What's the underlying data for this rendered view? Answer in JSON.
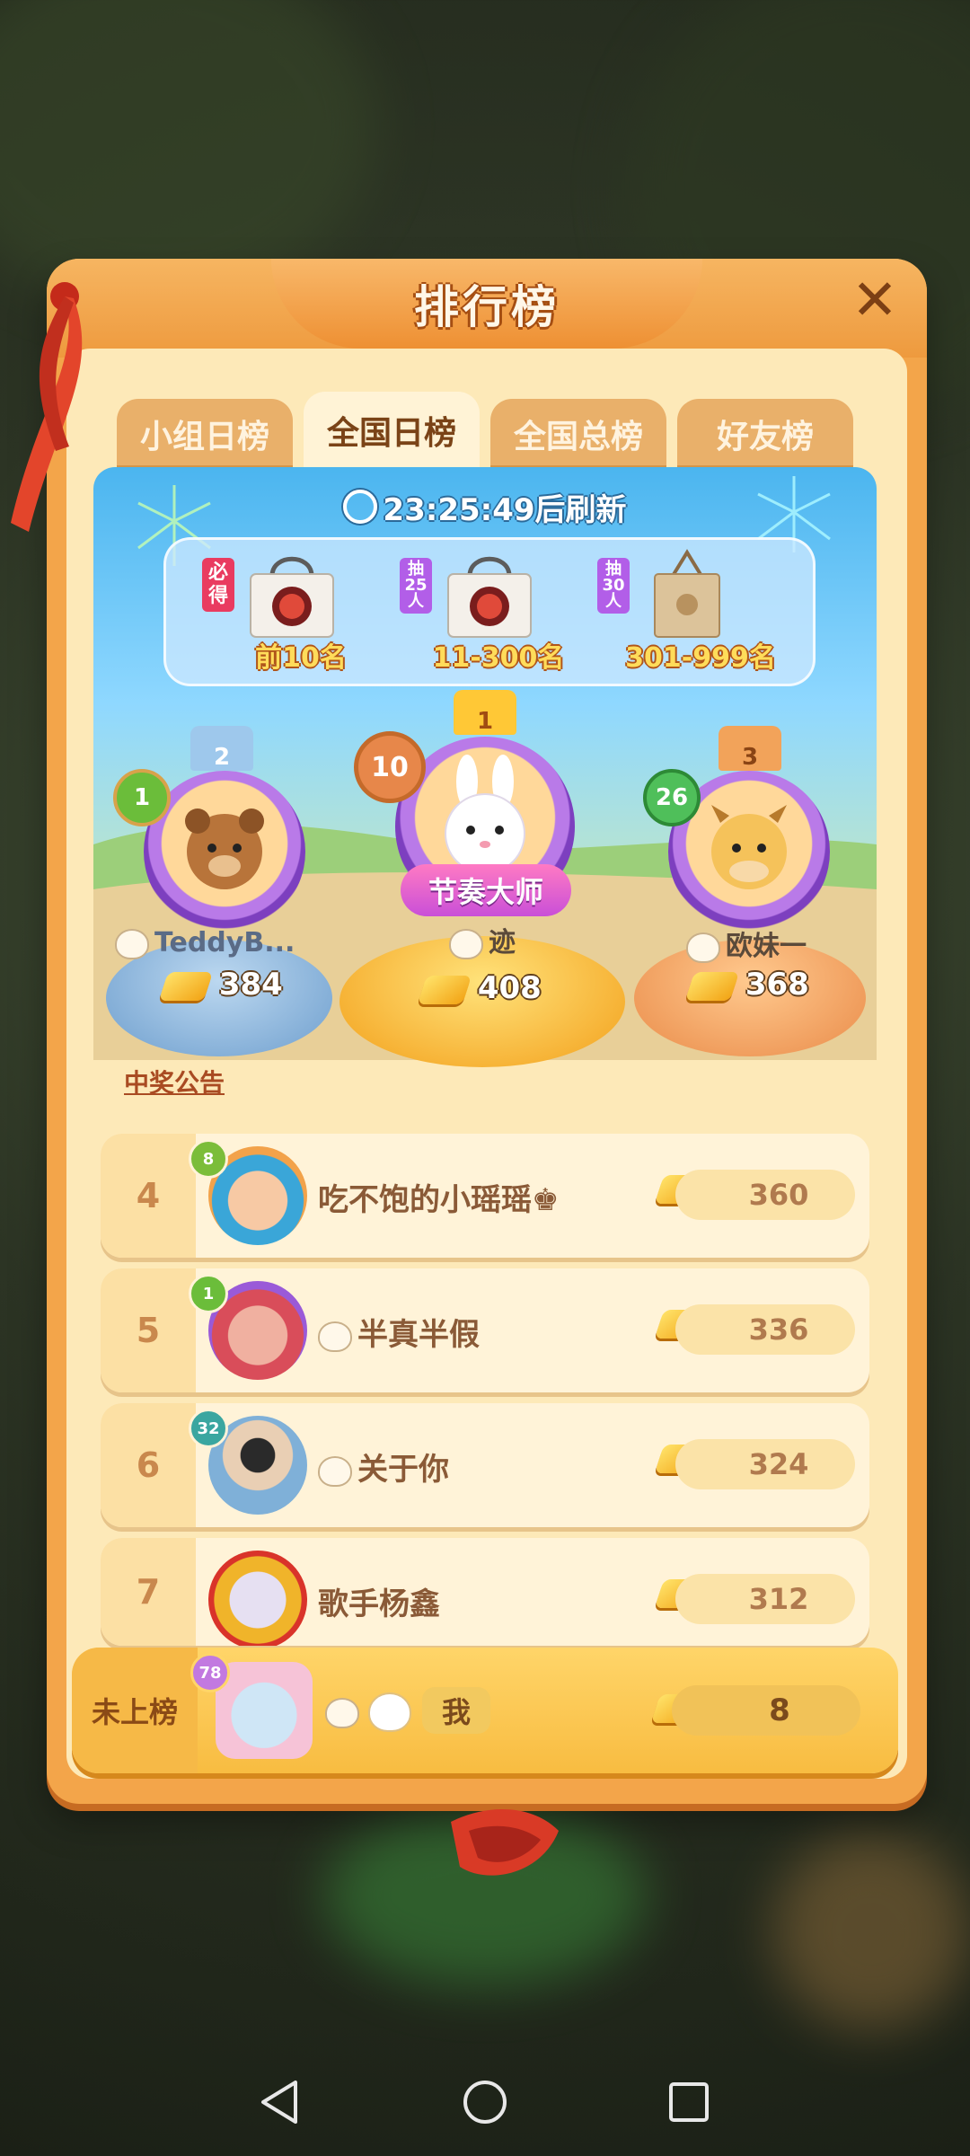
{
  "title": "排行榜",
  "close_icon": "✕",
  "tabs": [
    {
      "label": "小组日榜",
      "active": false
    },
    {
      "label": "全国日榜",
      "active": true
    },
    {
      "label": "全国总榜",
      "active": false
    },
    {
      "label": "好友榜",
      "active": false
    }
  ],
  "refresh_text": "23:25:49后刷新",
  "prizes": [
    {
      "tag": "必得",
      "label": "前10名"
    },
    {
      "tag": "抽25人",
      "label": "11-300名"
    },
    {
      "tag": "抽30人",
      "label": "301-999名"
    }
  ],
  "podium": {
    "first": {
      "rank": "1",
      "level": "10",
      "title_badge": "节奏大师",
      "name": "迹",
      "score": "408"
    },
    "second": {
      "rank": "2",
      "level": "1",
      "name": "TeddyB...",
      "score": "384"
    },
    "third": {
      "rank": "3",
      "level": "26",
      "name": "欧妹一",
      "score": "368"
    }
  },
  "announcement": "中奖公告",
  "rows": [
    {
      "rank": "4",
      "level": "8",
      "name": "吃不饱的小瑶瑶♚",
      "score": "360"
    },
    {
      "rank": "5",
      "level": "1",
      "name": "半真半假",
      "score": "336"
    },
    {
      "rank": "6",
      "level": "32",
      "name": "关于你",
      "score": "324"
    },
    {
      "rank": "7",
      "level": "",
      "name": "歌手杨鑫",
      "score": "312"
    }
  ],
  "me": {
    "rank_label": "未上榜",
    "level": "78",
    "tag": "我",
    "score": "8"
  },
  "nav": {
    "back_icon": "back-triangle",
    "home_icon": "home-circle",
    "recents_icon": "recents-square"
  },
  "colors": {
    "panel": "#f3a54a",
    "inner": "#fde9b8",
    "sky": "#4bb5ef",
    "gold": "#ffdc5a"
  }
}
